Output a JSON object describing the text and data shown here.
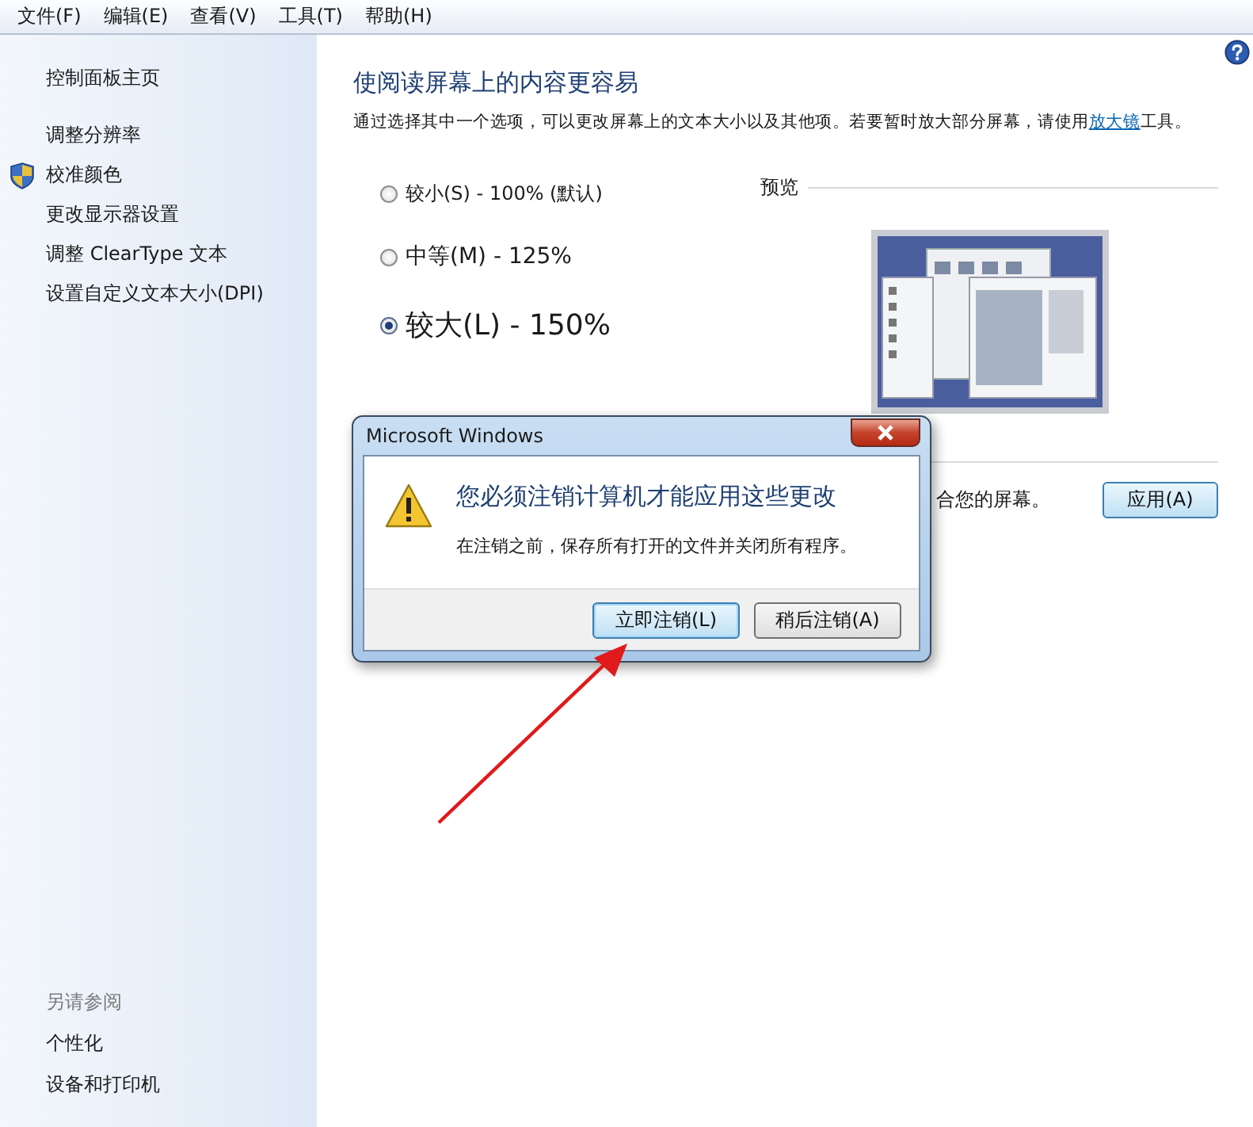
{
  "menu": [
    {
      "label": "文件(F)"
    },
    {
      "label": "编辑(E)"
    },
    {
      "label": "查看(V)"
    },
    {
      "label": "工具(T)"
    },
    {
      "label": "帮助(H)"
    }
  ],
  "sidebar": {
    "items": [
      {
        "label": "控制面板主页",
        "shield": false
      },
      {
        "label": "调整分辨率",
        "shield": false
      },
      {
        "label": "校准颜色",
        "shield": true
      },
      {
        "label": "更改显示器设置",
        "shield": false
      },
      {
        "label": "调整 ClearType 文本",
        "shield": false
      },
      {
        "label": "设置自定义文本大小(DPI)",
        "shield": false
      }
    ],
    "see_also": {
      "heading": "另请参阅",
      "items": [
        {
          "label": "个性化"
        },
        {
          "label": "设备和打印机"
        }
      ]
    }
  },
  "main": {
    "title": "使阅读屏幕上的内容更容易",
    "description": "通过选择其中一个选项，可以更改屏幕上的文本大小以及其他项。若要暂时放大部分屏幕，请使用",
    "link": "放大镜",
    "description_end": "工具。",
    "options": [
      {
        "label": "较小(S) - 100% (默认)",
        "selected": false
      },
      {
        "label": "中等(M) - 125%",
        "selected": false
      },
      {
        "label": "较大(L) - 150%",
        "selected": true
      }
    ],
    "preview": {
      "label": "预览"
    },
    "partial_text": "合您的屏幕。",
    "apply_button": "应用(A)"
  },
  "dialog": {
    "title": "Microsoft Windows",
    "heading": "您必须注销计算机才能应用这些更改",
    "message": "在注销之前，保存所有打开的文件并关闭所有程序。",
    "buttons": [
      {
        "label": "立即注销(L)",
        "default": true
      },
      {
        "label": "稍后注销(A)",
        "default": false
      }
    ]
  }
}
